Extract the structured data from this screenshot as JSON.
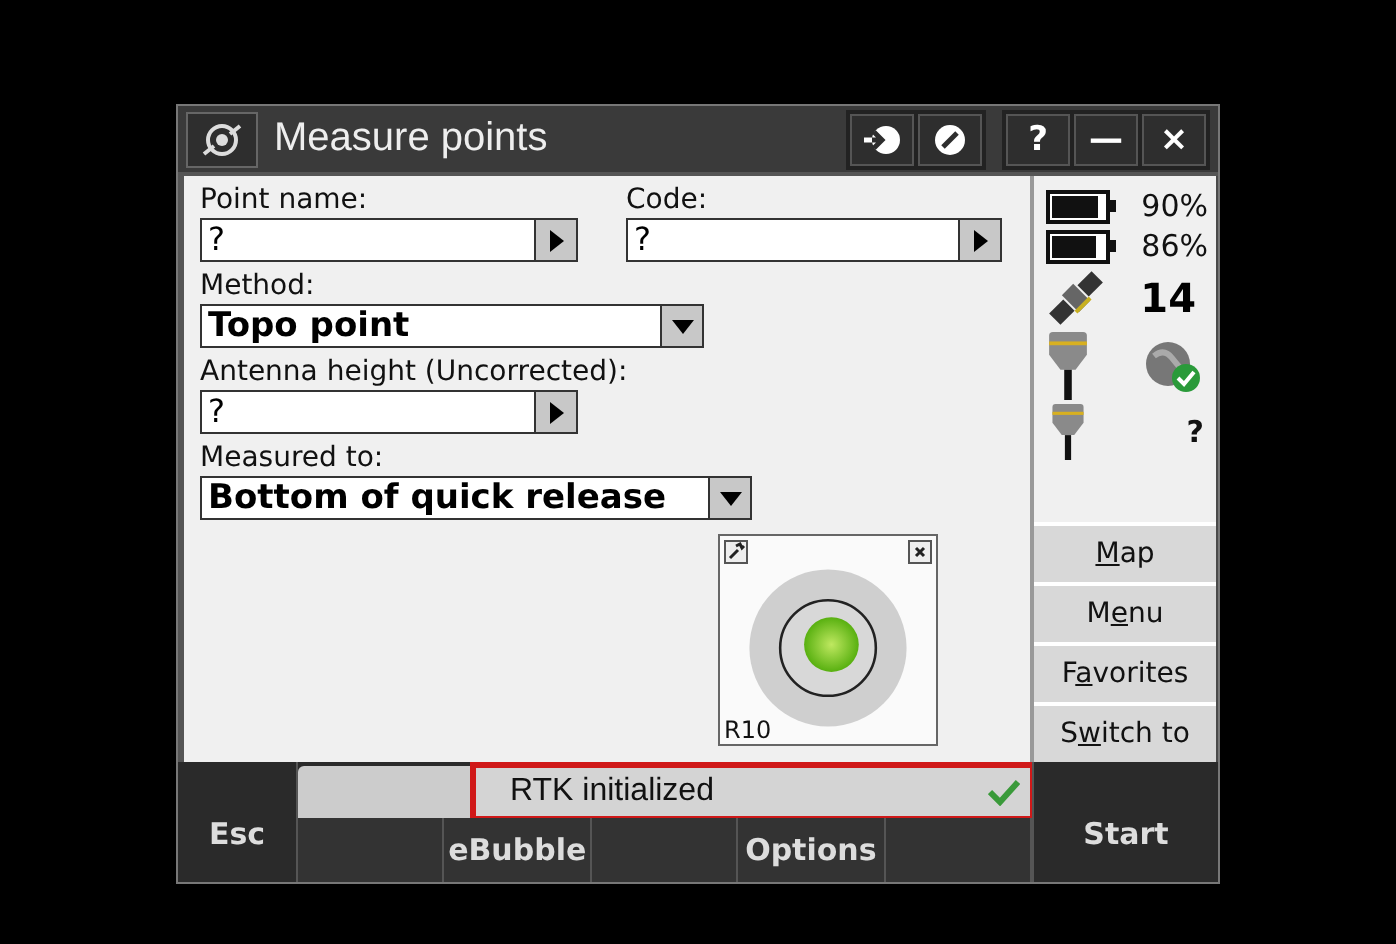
{
  "window": {
    "title": "Measure points",
    "system_buttons": [
      "?",
      "—",
      "×"
    ]
  },
  "form": {
    "fields": [
      {
        "kind": "arrow",
        "label": "Point name:",
        "value": "?"
      },
      {
        "kind": "arrow",
        "label": "Code:",
        "value": "?"
      },
      {
        "kind": "dropdown",
        "label": "Method:",
        "value": "Topo point"
      },
      {
        "kind": "arrow",
        "label": "Antenna height (Uncorrected):",
        "value": "?"
      },
      {
        "kind": "dropdown",
        "label": "Measured to:",
        "value": "Bottom of quick release"
      }
    ]
  },
  "status_panel": {
    "batteries": [
      {
        "reading": "90%",
        "level": 0.9
      },
      {
        "reading": "86%",
        "level": 0.86
      }
    ],
    "satellites": "14",
    "rover_reading": "?"
  },
  "side_buttons": [
    {
      "mnemonic": "M",
      "after": "ap"
    },
    {
      "before": "M",
      "mnemonic": "e",
      "after": "nu"
    },
    {
      "before": "F",
      "mnemonic": "a",
      "after": "vorites"
    },
    {
      "before": "S",
      "mnemonic": "w",
      "after": "itch to"
    }
  ],
  "ebubble": {
    "label": "R10"
  },
  "status_bar": {
    "message": "RTK initialized",
    "ok": true,
    "highlighted": true
  },
  "escape_key": "Esc",
  "softkeys": [
    {
      "kind": "blank"
    },
    {
      "kind": "key",
      "label": "eBubble"
    },
    {
      "kind": "blank"
    },
    {
      "kind": "key",
      "label": "Options"
    },
    {
      "kind": "blank"
    }
  ],
  "start_key": "Start"
}
